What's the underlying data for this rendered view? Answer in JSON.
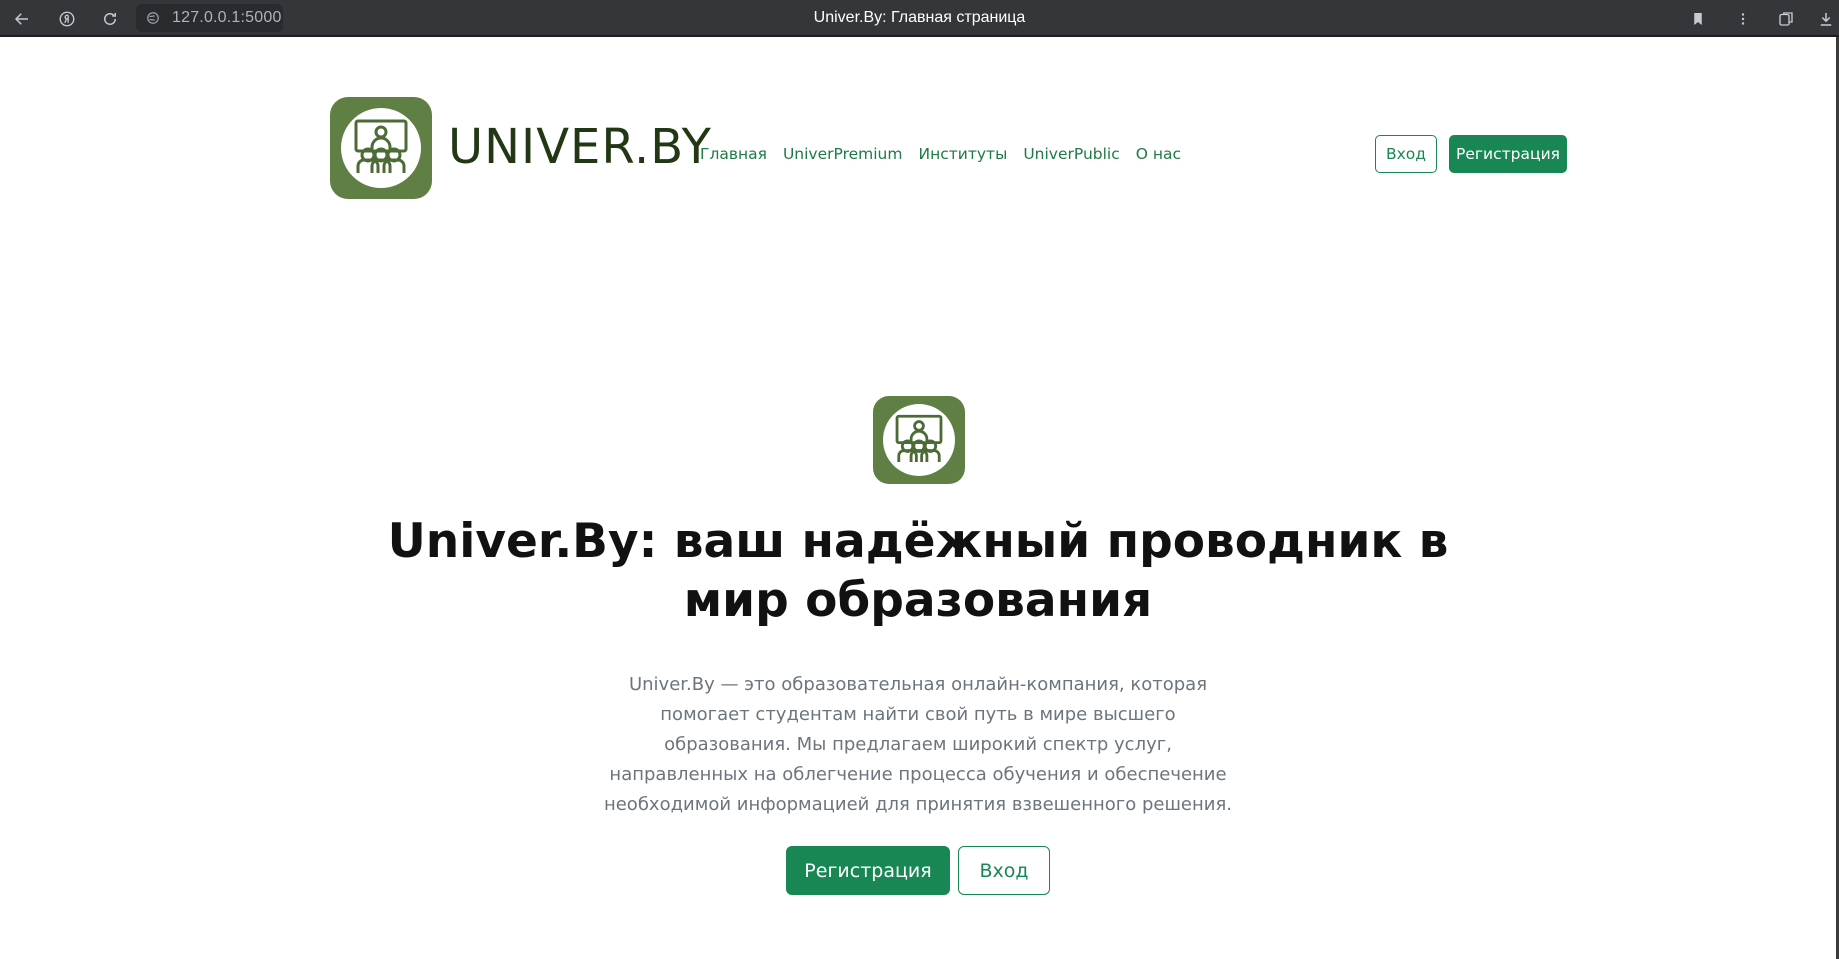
{
  "browser": {
    "url": "127.0.0.1:5000",
    "tab_title": "Univer.By: Главная страница",
    "icons": [
      "back-icon",
      "yandex-icon",
      "reload-icon",
      "site-info-icon",
      "bookmark-icon",
      "more-icon",
      "extensions-icon",
      "download-icon"
    ]
  },
  "header": {
    "brand": "UNIVER.BY",
    "nav": [
      "Главная",
      "UniverPremium",
      "Институты",
      "UniverPublic",
      "О нас"
    ],
    "login_label": "Вход",
    "register_label": "Регистрация"
  },
  "hero": {
    "title": "Univer.By: ваш надёжный проводник в мир образования",
    "text": "Univer.By — это образовательная онлайн-компания, которая помогает студентам найти свой путь в мире высшего образования. Мы предлагаем широкий спектр услуг, направленных на облегчение процесса обучения и обеспечение необходимой информацией для принятия взвешенного решения.",
    "register_label": "Регистрация",
    "login_label": "Вход"
  },
  "colors": {
    "brand_green": "#5f7f44",
    "brand_text": "#223814",
    "accent": "#198754",
    "chrome": "#35363a"
  }
}
